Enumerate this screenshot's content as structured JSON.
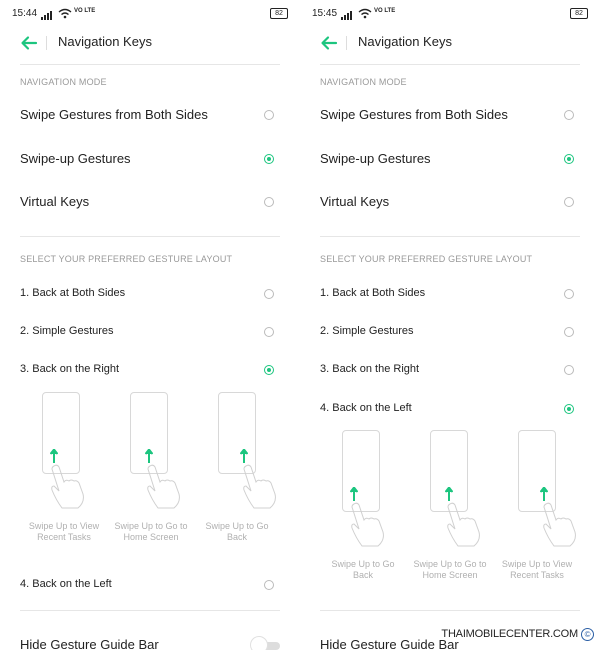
{
  "accent": "#1cc57f",
  "left": {
    "status": {
      "time": "15:44",
      "volte": "VO LTE",
      "battery": "82"
    },
    "title": "Navigation Keys",
    "nav_mode_header": "NAVIGATION MODE",
    "nav_modes": [
      {
        "label": "Swipe Gestures from Both Sides",
        "selected": false
      },
      {
        "label": "Swipe-up Gestures",
        "selected": true
      },
      {
        "label": "Virtual Keys",
        "selected": false
      }
    ],
    "layout_header": "SELECT YOUR PREFERRED GESTURE LAYOUT",
    "layouts": [
      {
        "label": "1. Back at Both Sides",
        "selected": false
      },
      {
        "label": "2. Simple Gestures",
        "selected": false
      },
      {
        "label": "3. Back on the Right",
        "selected": true
      }
    ],
    "illustrations": [
      {
        "line1": "Swipe Up to View",
        "line2": "Recent Tasks",
        "arrow_pos": "left"
      },
      {
        "line1": "Swipe Up to Go to",
        "line2": "Home Screen",
        "arrow_pos": "center"
      },
      {
        "line1": "Swipe Up to Go",
        "line2": "Back",
        "arrow_pos": "right"
      }
    ],
    "extra_layout": {
      "label": "4. Back on the Left",
      "selected": false
    },
    "hide_bar": "Hide Gesture Guide Bar"
  },
  "right": {
    "status": {
      "time": "15:45",
      "volte": "VO LTE",
      "battery": "82"
    },
    "title": "Navigation Keys",
    "nav_mode_header": "NAVIGATION MODE",
    "nav_modes": [
      {
        "label": "Swipe Gestures from Both Sides",
        "selected": false
      },
      {
        "label": "Swipe-up Gestures",
        "selected": true
      },
      {
        "label": "Virtual Keys",
        "selected": false
      }
    ],
    "layout_header": "SELECT YOUR PREFERRED GESTURE LAYOUT",
    "layouts": [
      {
        "label": "1. Back at Both Sides",
        "selected": false
      },
      {
        "label": "2. Simple Gestures",
        "selected": false
      },
      {
        "label": "3. Back on the Right",
        "selected": false
      },
      {
        "label": "4. Back on the Left",
        "selected": true
      }
    ],
    "illustrations": [
      {
        "line1": "Swipe Up to Go",
        "line2": "Back",
        "arrow_pos": "left"
      },
      {
        "line1": "Swipe Up to Go to",
        "line2": "Home Screen",
        "arrow_pos": "center"
      },
      {
        "line1": "Swipe Up to View",
        "line2": "Recent Tasks",
        "arrow_pos": "right"
      }
    ],
    "hide_bar": "Hide Gesture Guide Bar"
  },
  "watermark": "THAIMOBILECENTER.COM",
  "watermark_symbol": "©"
}
